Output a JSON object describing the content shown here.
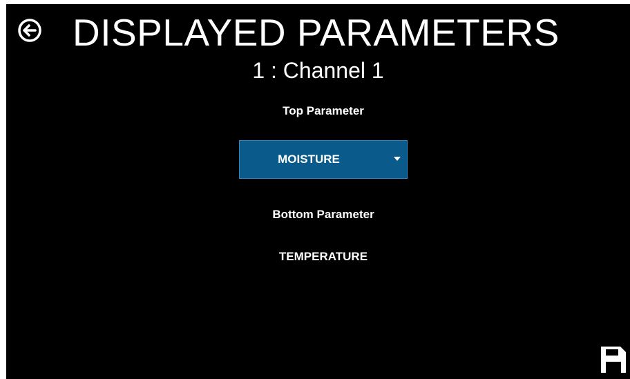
{
  "header": {
    "title": "DISPLAYED PARAMETERS",
    "back_icon": "arrow-left-circle-icon"
  },
  "channel": {
    "label": "1 : Channel 1"
  },
  "top_parameter": {
    "label": "Top Parameter",
    "selected_value": "MOISTURE",
    "dropdown_color": "#0a5b8c"
  },
  "bottom_parameter": {
    "label": "Bottom Parameter",
    "value": "TEMPERATURE"
  },
  "footer": {
    "save_icon": "save-disk-icon"
  },
  "colors": {
    "background": "#000000",
    "text": "#ffffff",
    "accent": "#0a5b8c"
  }
}
